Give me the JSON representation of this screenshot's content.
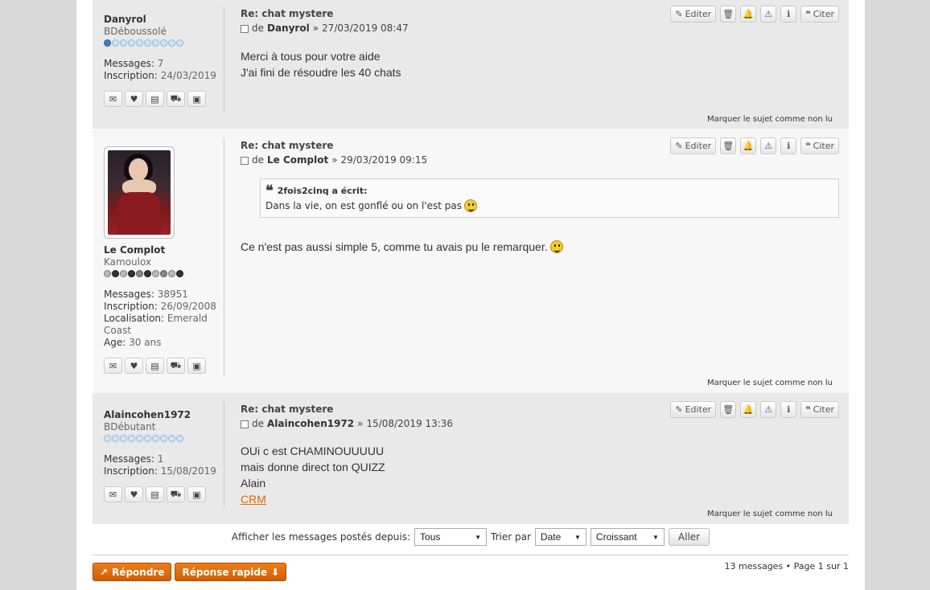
{
  "posts": [
    {
      "title": "Re: chat mystere",
      "author": "Danyrol",
      "date": "27/03/2019 08:47",
      "rank": "BDéboussolé",
      "messages_label": "Messages:",
      "messages": "7",
      "inscription_label": "Inscription:",
      "inscription": "24/03/2019",
      "lines": [
        "Merci à tous pour votre aide",
        "J'ai fini de résoudre les 40 chats"
      ]
    },
    {
      "title": "Re: chat mystere",
      "author": "Le Complot",
      "date": "29/03/2019 09:15",
      "rank": "Kamoulox",
      "messages_label": "Messages:",
      "messages": "38951",
      "inscription_label": "Inscription:",
      "inscription": "26/09/2008",
      "localisation_label": "Localisation:",
      "localisation": "Emerald Coast",
      "age_label": "Age:",
      "age": "30 ans",
      "quote_author": "2fois2cinq a écrit:",
      "quote_text": "Dans la vie, on est gonflé ou on l'est pas",
      "lines": [
        "Ce n'est pas aussi simple 5, comme tu avais pu le remarquer."
      ]
    },
    {
      "title": "Re: chat mystere",
      "author": "Alaincohen1972",
      "date": "15/08/2019 13:36",
      "rank": "BDébutant",
      "messages_label": "Messages:",
      "messages": "1",
      "inscription_label": "Inscription:",
      "inscription": "15/08/2019",
      "lines": [
        "OUi c est CHAMINOUUUUU",
        "mais donne direct ton QUIZZ",
        "Alain"
      ],
      "link": "CRM"
    }
  ],
  "labels": {
    "by": "de",
    "sep": "»",
    "edit": "Editer",
    "quote": "Citer",
    "mark_unread": "Marquer le sujet comme non lu"
  },
  "filter": {
    "since_label": "Afficher les messages postés depuis:",
    "since_value": "Tous",
    "sort_label": "Trier par",
    "sort_value": "Date",
    "order_value": "Croissant",
    "go": "Aller"
  },
  "footer": {
    "reply": "Répondre",
    "quick_reply": "Réponse rapide",
    "pagination": "13 messages • Page 1 sur 1"
  },
  "colors": {
    "accent": "#e06a00",
    "post_dark": "#e9e9e9",
    "post_light": "#f7f7f7"
  }
}
